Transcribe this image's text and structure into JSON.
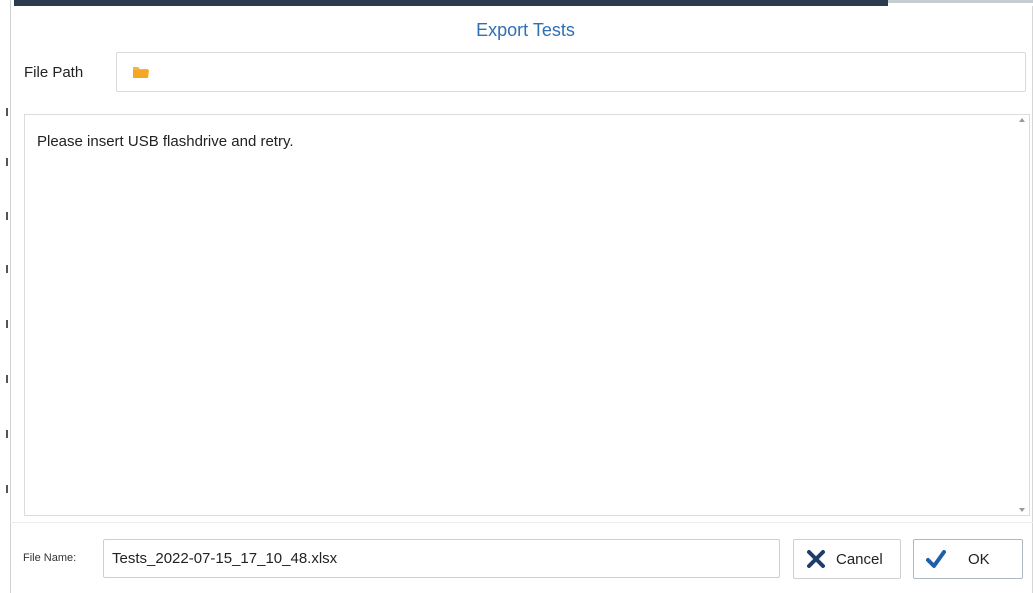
{
  "dialog": {
    "title": "Export Tests"
  },
  "file_path": {
    "label": "File Path",
    "value": "",
    "icon": "folder-icon"
  },
  "message": {
    "text": "Please insert USB flashdrive and retry."
  },
  "file_name": {
    "label": "File Name:",
    "value": "Tests_2022-07-15_17_10_48.xlsx"
  },
  "buttons": {
    "cancel_label": "Cancel",
    "cancel_icon": "close-icon",
    "ok_label": "OK",
    "ok_icon": "checkmark-icon"
  },
  "colors": {
    "title": "#2f6fb3",
    "folder": "#f5a623",
    "cancel_icon": "#1f3d66",
    "ok_icon": "#1f5fa8"
  }
}
